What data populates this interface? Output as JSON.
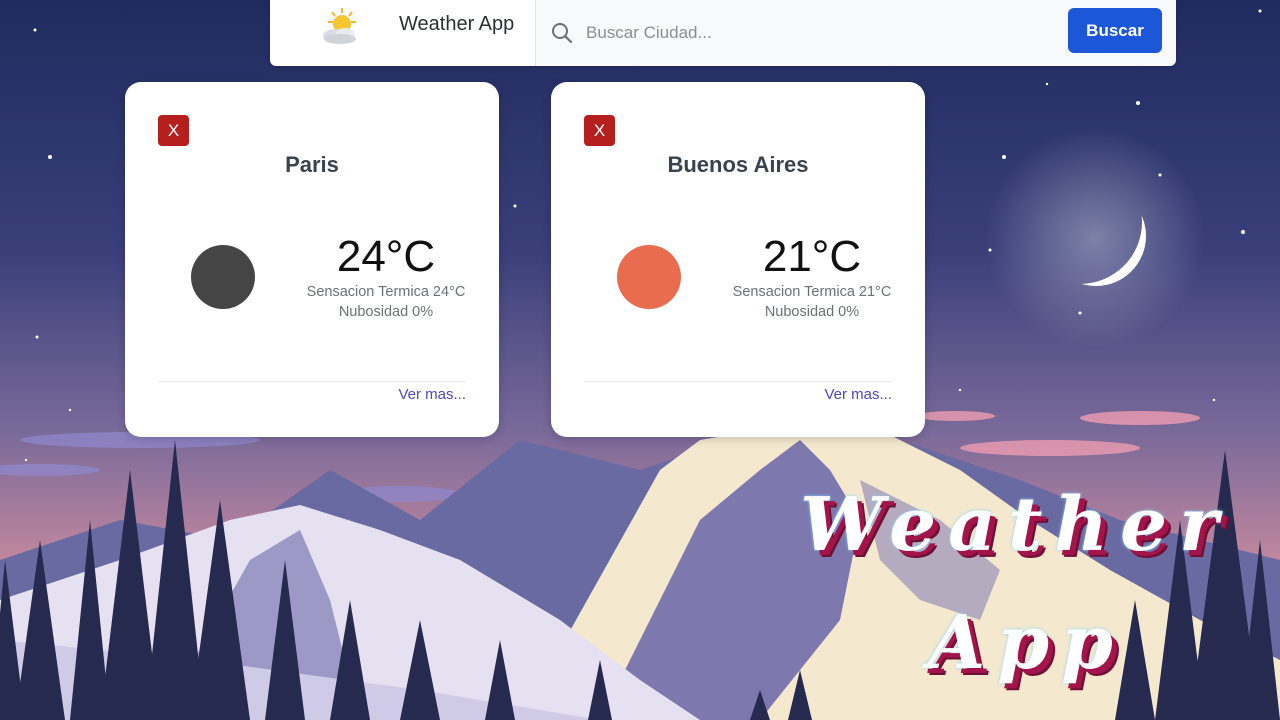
{
  "header": {
    "app_title": "Weather App",
    "logo_icon": "sun-cloud-icon",
    "search": {
      "placeholder": "Buscar Ciudad...",
      "value": "",
      "button_label": "Buscar"
    }
  },
  "cards": [
    {
      "close_label": "X",
      "city": "Paris",
      "temperature": "24°C",
      "feels_like": "Sensacion Termica 24°C",
      "cloudiness": "Nubosidad 0%",
      "more_link": "Ver mas...",
      "indicator_color": "#454545"
    },
    {
      "close_label": "X",
      "city": "Buenos Aires",
      "temperature": "21°C",
      "feels_like": "Sensacion Termica 21°C",
      "cloudiness": "Nubosidad 0%",
      "more_link": "Ver mas...",
      "indicator_color": "#e86c4d"
    }
  ],
  "decorative_title": {
    "line1": "Weather",
    "line2": "App"
  },
  "colors": {
    "accent": "#1b57d6",
    "close_button": "#b5201f",
    "link": "#4b47c9"
  }
}
